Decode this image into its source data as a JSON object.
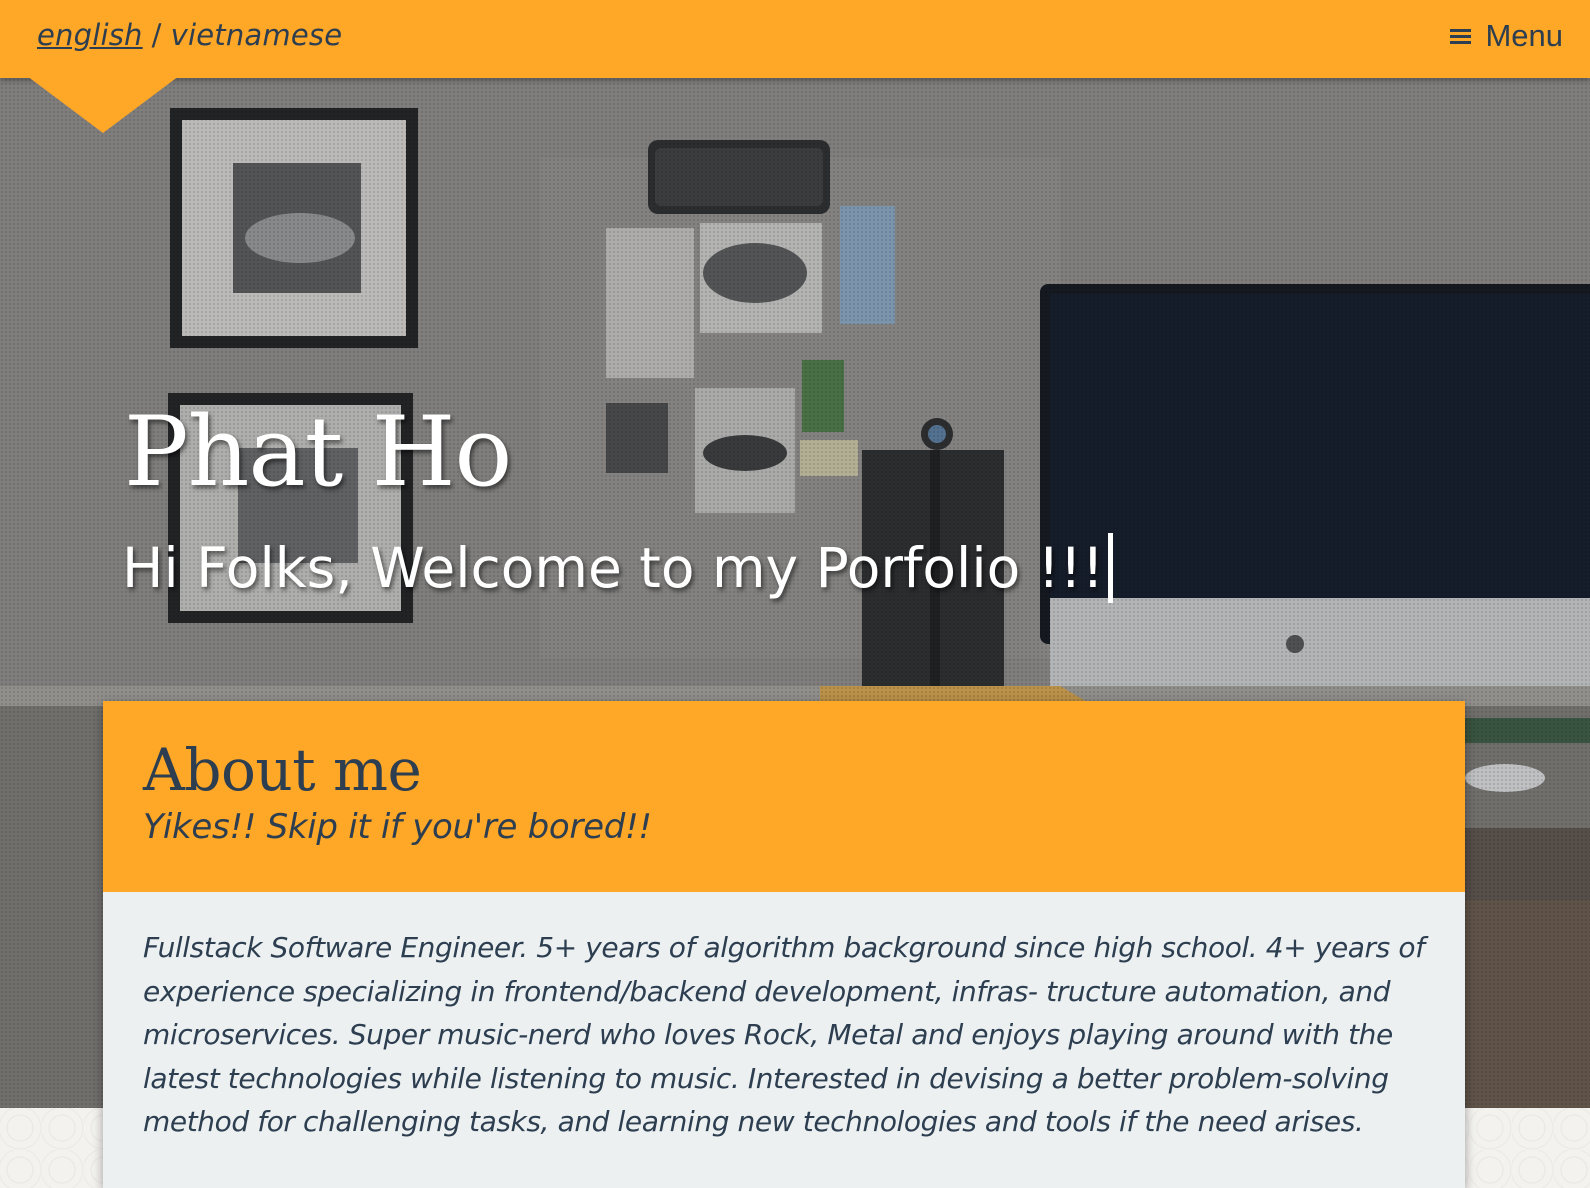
{
  "nav": {
    "lang_active": "english",
    "lang_separator": "/",
    "lang_other": "vietnamese",
    "menu_label": "Menu",
    "menu_icon": "hamburger-icon"
  },
  "hero": {
    "title": "Phat Ho",
    "subtitle": "Hi Folks, Welcome to my Porfolio !!!"
  },
  "about": {
    "title": "About me",
    "tagline": "Yikes!! Skip it if you're bored!!",
    "body": "Fullstack Software Engineer. 5+ years of algorithm background since high school. 4+ years of experience specializing in frontend/backend development, infras- tructure automation, and microservices. Super music-nerd who loves Rock, Metal and enjoys playing around with the latest technologies while listening to music. Interested in devising a better problem-solving method for challenging tasks, and learning new technologies and tools if the need arises."
  },
  "colors": {
    "accent": "#ffa726",
    "text_dark": "#2c3e50",
    "card_body": "#ecf0f1"
  }
}
